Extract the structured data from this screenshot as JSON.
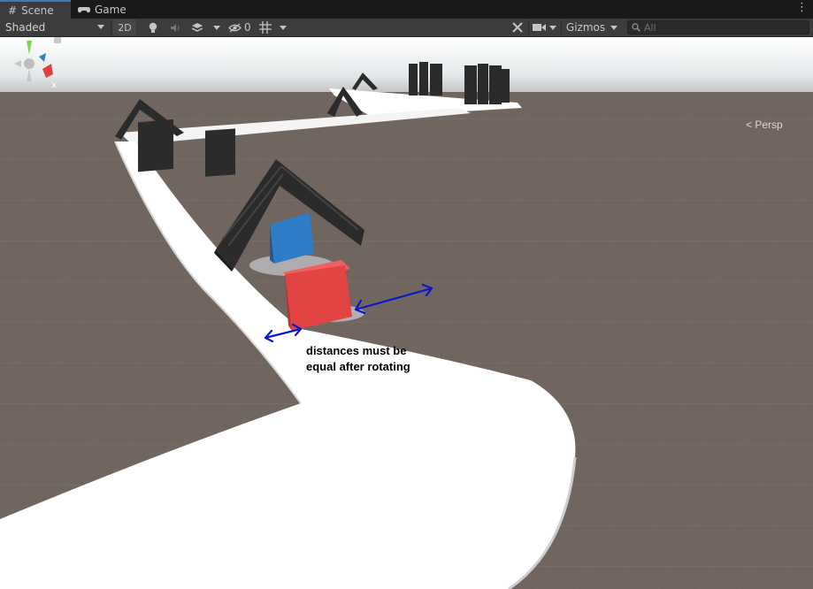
{
  "tabs": [
    {
      "label": "Scene",
      "icon": "grid-hash-icon",
      "active": true
    },
    {
      "label": "Game",
      "icon": "gamepad-icon",
      "active": false
    }
  ],
  "toolbar": {
    "shading_mode": "Shaded",
    "mode_2d": "2D",
    "hidden_count": "0",
    "gizmos_label": "Gizmos",
    "search_placeholder": "All"
  },
  "viewport": {
    "projection_label": "< Persp",
    "gizmo_axis_label": "x",
    "annotation_line1": "distances must be",
    "annotation_line2": "equal after rotating"
  },
  "colors": {
    "ground": "#716560",
    "sky": "#eef3f6",
    "track": "#ffffff",
    "red_cube": "#e84545",
    "blue_cube": "#2f7cc7",
    "obstacle": "#2b2b2b",
    "annotation_arrow": "#0a17c9"
  }
}
